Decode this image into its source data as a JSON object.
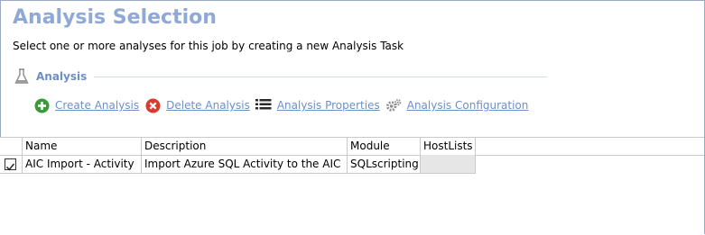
{
  "page": {
    "title": "Analysis Selection",
    "subtitle": "Select one or more analyses for this job by creating a new Analysis Task"
  },
  "section": {
    "title": "Analysis",
    "icon": "flask-icon"
  },
  "toolbar": {
    "create": {
      "label": "Create Analysis",
      "icon": "plus-circle-icon"
    },
    "delete": {
      "label": "Delete Analysis",
      "icon": "x-circle-icon"
    },
    "properties": {
      "label": "Analysis Properties",
      "icon": "list-icon"
    },
    "configuration": {
      "label": "Analysis Configuration",
      "icon": "gears-icon"
    }
  },
  "table": {
    "columns": [
      "Name",
      "Description",
      "Module",
      "HostLists"
    ],
    "rows": [
      {
        "checked": true,
        "name": "AIC Import - Activity",
        "description": "Import Azure SQL Activity to the AIC",
        "module": "SQLscripting",
        "hostlists": ""
      }
    ]
  },
  "colors": {
    "title": "#8fa8d6",
    "link": "#6d8fc8",
    "create_icon": "#3a9a3a",
    "delete_icon": "#d83a2e"
  }
}
